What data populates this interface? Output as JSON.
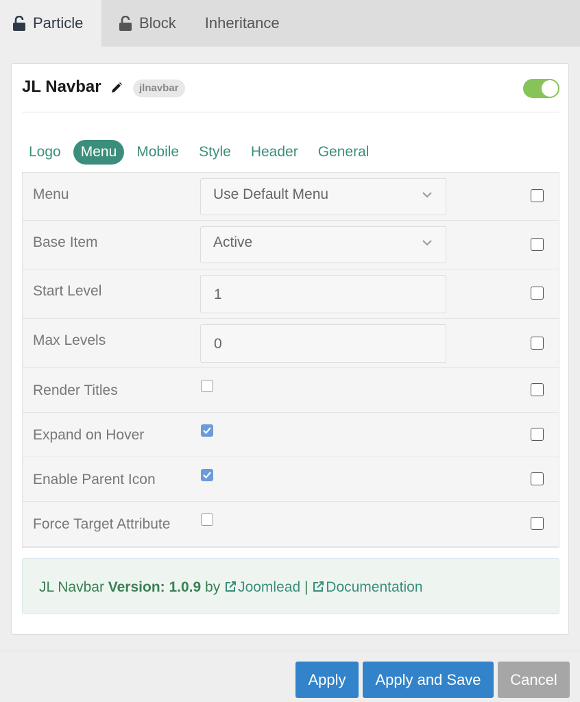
{
  "top_tabs": [
    {
      "label": "Particle",
      "icon": "lock-open-icon"
    },
    {
      "label": "Block",
      "icon": "lock-open-icon"
    },
    {
      "label": "Inheritance"
    }
  ],
  "header": {
    "title": "JL Navbar",
    "badge": "jlnavbar",
    "enabled": true
  },
  "sub_tabs": [
    "Logo",
    "Menu",
    "Mobile",
    "Style",
    "Header",
    "General"
  ],
  "active_sub_tab": "Menu",
  "fields": [
    {
      "label": "Menu",
      "type": "select",
      "value": "Use Default Menu",
      "override": false
    },
    {
      "label": "Base Item",
      "type": "select",
      "value": "Active",
      "override": false
    },
    {
      "label": "Start Level",
      "type": "text",
      "value": "1",
      "override": false
    },
    {
      "label": "Max Levels",
      "type": "text",
      "value": "0",
      "override": false
    },
    {
      "label": "Render Titles",
      "type": "checkbox",
      "checked": false,
      "override": false
    },
    {
      "label": "Expand on Hover",
      "type": "checkbox",
      "checked": true,
      "override": false
    },
    {
      "label": "Enable Parent Icon",
      "type": "checkbox",
      "checked": true,
      "override": false
    },
    {
      "label": "Force Target Attribute",
      "type": "checkbox",
      "checked": false,
      "override": false
    }
  ],
  "info": {
    "name": "JL Navbar",
    "version_label": "Version: 1.0.9",
    "by": "by",
    "author_link": "Joomlead",
    "separator": "|",
    "docs_link": "Documentation"
  },
  "buttons": {
    "apply": "Apply",
    "apply_save": "Apply and Save",
    "cancel": "Cancel"
  },
  "colors": {
    "accent": "#3a8e7b",
    "toggle_on": "#86c45a",
    "primary_button": "#3283c9",
    "cancel_button": "#a6a6a6",
    "checkbox_checked": "#6b9bd8"
  }
}
